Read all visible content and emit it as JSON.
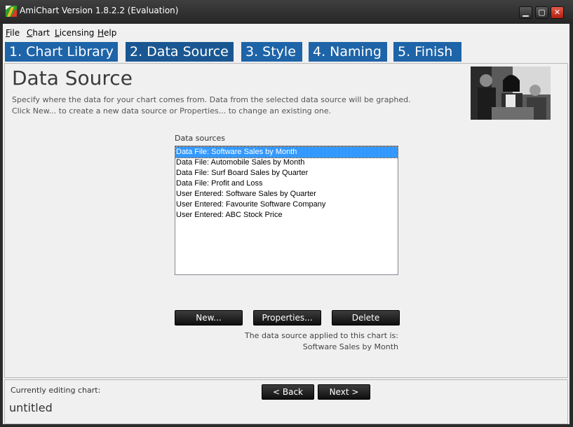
{
  "window": {
    "title": "AmiChart Version 1.8.2.2 (Evaluation)",
    "controls": [
      "minimize",
      "maximize",
      "close"
    ]
  },
  "menu": [
    {
      "label": "File",
      "accel": "F",
      "rest": "ile"
    },
    {
      "label": "Chart",
      "accel": "C",
      "rest": "hart"
    },
    {
      "label": "Licensing",
      "accel": "L",
      "rest": "icensing"
    },
    {
      "label": "Help",
      "accel": "H",
      "rest": "elp"
    }
  ],
  "tabs": [
    {
      "label": "1. Chart Library"
    },
    {
      "label": "2. Data Source"
    },
    {
      "label": "3. Style"
    },
    {
      "label": "4. Naming"
    },
    {
      "label": "5. Finish"
    }
  ],
  "page": {
    "title": "Data Source",
    "description_line1": "Specify where the data for your chart comes from. Data from the selected data source will be graphed.",
    "description_line2": "Click New... to create a new data source or Properties... to change an existing one."
  },
  "data_sources": {
    "label": "Data sources",
    "items": [
      "Data File: Software Sales by Month",
      "Data File: Automobile Sales by Month",
      "Data File: Surf Board Sales by Quarter",
      "Data File: Profit and Loss",
      "User Entered: Software Sales by Quarter",
      "User Entered: Favourite Software Company",
      "User Entered: ABC Stock Price"
    ],
    "selected_index": 0
  },
  "buttons": {
    "new": "New...",
    "properties": "Properties...",
    "delete": "Delete",
    "back": "< Back",
    "next": "Next >"
  },
  "applied": {
    "label": "The data source applied to this chart is:",
    "value": "Software Sales by Month"
  },
  "footer": {
    "label": "Currently editing chart:",
    "chart_name": "untitled"
  },
  "colors": {
    "tab_bg": "#1e64a8",
    "selection": "#3399ff",
    "close_button": "#c42b1c"
  }
}
